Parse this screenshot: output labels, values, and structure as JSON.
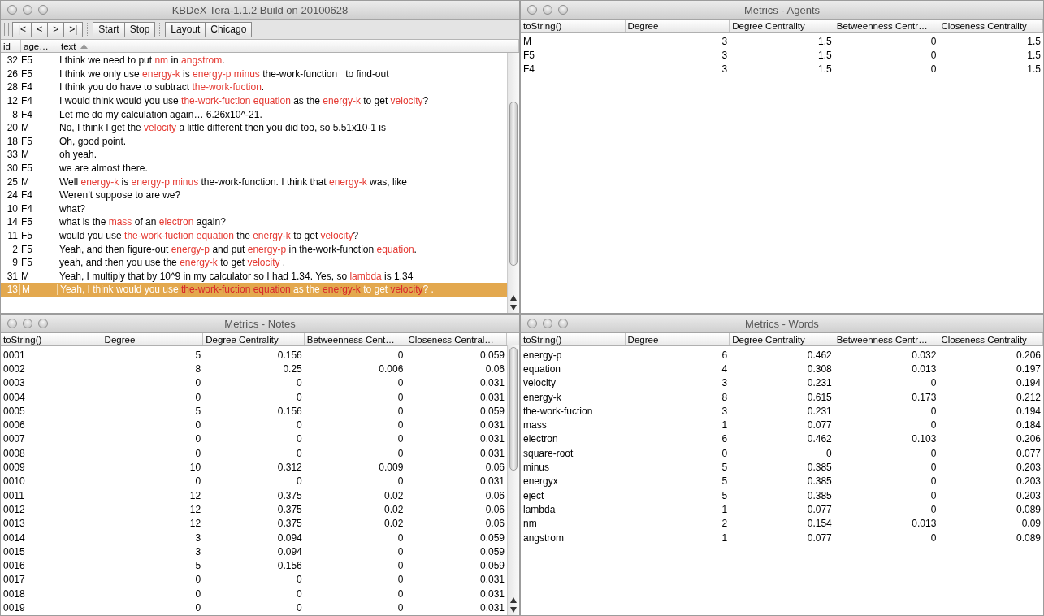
{
  "main_window": {
    "title": "KBDeX Tera-1.1.2 Build on 20100628",
    "toolbar_groups": [
      [
        "|<",
        "<",
        ">",
        ">|"
      ],
      [
        "Start",
        "Stop"
      ],
      [
        "Layout",
        "Chicago"
      ]
    ],
    "table": {
      "columns": [
        {
          "label": "id",
          "sorted": false
        },
        {
          "label": "age…",
          "sorted": false
        },
        {
          "label": "text",
          "sorted": true
        }
      ],
      "rows": [
        {
          "id": "32",
          "agent": "F5",
          "selected": false,
          "text": [
            {
              "t": "I think we need to put ",
              "keyword": false
            },
            {
              "t": "nm",
              "keyword": true
            },
            {
              "t": " in ",
              "keyword": false
            },
            {
              "t": "angstrom",
              "keyword": true
            },
            {
              "t": ".",
              "keyword": false
            }
          ]
        },
        {
          "id": "26",
          "agent": "F5",
          "selected": false,
          "text": [
            {
              "t": "I think we only use ",
              "keyword": false
            },
            {
              "t": "energy-k",
              "keyword": true
            },
            {
              "t": " is ",
              "keyword": false
            },
            {
              "t": "energy-p minus",
              "keyword": true
            },
            {
              "t": " the-work-function   to find-out",
              "keyword": false
            }
          ]
        },
        {
          "id": "28",
          "agent": "F4",
          "selected": false,
          "text": [
            {
              "t": "I think you do have to subtract ",
              "keyword": false
            },
            {
              "t": "the-work-fuction",
              "keyword": true
            },
            {
              "t": ".",
              "keyword": false
            }
          ]
        },
        {
          "id": "12",
          "agent": "F4",
          "selected": false,
          "text": [
            {
              "t": "I would think would you use ",
              "keyword": false
            },
            {
              "t": "the-work-fuction equation",
              "keyword": true
            },
            {
              "t": " as the ",
              "keyword": false
            },
            {
              "t": "energy-k",
              "keyword": true
            },
            {
              "t": " to get ",
              "keyword": false
            },
            {
              "t": "velocity",
              "keyword": true
            },
            {
              "t": "?",
              "keyword": false
            }
          ]
        },
        {
          "id": "8",
          "agent": "F4",
          "selected": false,
          "text": [
            {
              "t": "Let me do my calculation again… 6.26x10^-21.",
              "keyword": false
            }
          ]
        },
        {
          "id": "20",
          "agent": "M",
          "selected": false,
          "text": [
            {
              "t": "No, I think I get the ",
              "keyword": false
            },
            {
              "t": "velocity",
              "keyword": true
            },
            {
              "t": " a little different then you did too, so 5.51x10-1 is",
              "keyword": false
            }
          ]
        },
        {
          "id": "18",
          "agent": "F5",
          "selected": false,
          "text": [
            {
              "t": "Oh, good point.",
              "keyword": false
            }
          ]
        },
        {
          "id": "33",
          "agent": "M",
          "selected": false,
          "text": [
            {
              "t": "oh yeah.",
              "keyword": false
            }
          ]
        },
        {
          "id": "30",
          "agent": "F5",
          "selected": false,
          "text": [
            {
              "t": "we are almost there.",
              "keyword": false
            }
          ]
        },
        {
          "id": "25",
          "agent": "M",
          "selected": false,
          "text": [
            {
              "t": "Well ",
              "keyword": false
            },
            {
              "t": "energy-k",
              "keyword": true
            },
            {
              "t": " is ",
              "keyword": false
            },
            {
              "t": "energy-p minus",
              "keyword": true
            },
            {
              "t": " the-work-function. I think that ",
              "keyword": false
            },
            {
              "t": "energy-k",
              "keyword": true
            },
            {
              "t": " was, like",
              "keyword": false
            }
          ]
        },
        {
          "id": "24",
          "agent": "F4",
          "selected": false,
          "text": [
            {
              "t": "Weren’t suppose to are we?",
              "keyword": false
            }
          ]
        },
        {
          "id": "10",
          "agent": "F4",
          "selected": false,
          "text": [
            {
              "t": "what?",
              "keyword": false
            }
          ]
        },
        {
          "id": "14",
          "agent": "F5",
          "selected": false,
          "text": [
            {
              "t": "what is the ",
              "keyword": false
            },
            {
              "t": "mass",
              "keyword": true
            },
            {
              "t": " of an ",
              "keyword": false
            },
            {
              "t": "electron",
              "keyword": true
            },
            {
              "t": " again?",
              "keyword": false
            }
          ]
        },
        {
          "id": "11",
          "agent": "F5",
          "selected": false,
          "text": [
            {
              "t": "would you use ",
              "keyword": false
            },
            {
              "t": "the-work-fuction equation",
              "keyword": true
            },
            {
              "t": " the ",
              "keyword": false
            },
            {
              "t": "energy-k",
              "keyword": true
            },
            {
              "t": " to get ",
              "keyword": false
            },
            {
              "t": "velocity",
              "keyword": true
            },
            {
              "t": "?",
              "keyword": false
            }
          ]
        },
        {
          "id": "2",
          "agent": "F5",
          "selected": false,
          "text": [
            {
              "t": "Yeah, and then figure-out ",
              "keyword": false
            },
            {
              "t": "energy-p",
              "keyword": true
            },
            {
              "t": " and put ",
              "keyword": false
            },
            {
              "t": "energy-p",
              "keyword": true
            },
            {
              "t": " in the-work-function ",
              "keyword": false
            },
            {
              "t": "equation",
              "keyword": true
            },
            {
              "t": ".",
              "keyword": false
            }
          ]
        },
        {
          "id": "9",
          "agent": "F5",
          "selected": false,
          "text": [
            {
              "t": "yeah, and then you use the ",
              "keyword": false
            },
            {
              "t": "energy-k",
              "keyword": true
            },
            {
              "t": " to get ",
              "keyword": false
            },
            {
              "t": "velocity",
              "keyword": true
            },
            {
              "t": " .",
              "keyword": false
            }
          ]
        },
        {
          "id": "31",
          "agent": "M",
          "selected": false,
          "text": [
            {
              "t": "Yeah, I multiply that by 10^9 in my calculator so I had 1.34. Yes, so ",
              "keyword": false
            },
            {
              "t": "lambda",
              "keyword": true
            },
            {
              "t": " is 1.34",
              "keyword": false
            }
          ]
        },
        {
          "id": "13",
          "agent": "M",
          "selected": true,
          "text": [
            {
              "t": "Yeah, I think would you use ",
              "keyword": false
            },
            {
              "t": "the-work-fuction equation",
              "keyword": true
            },
            {
              "t": " as the ",
              "keyword": false
            },
            {
              "t": "energy-k",
              "keyword": true
            },
            {
              "t": " to get ",
              "keyword": false
            },
            {
              "t": "velocity",
              "keyword": true
            },
            {
              "t": "? .",
              "keyword": false
            }
          ]
        }
      ]
    }
  },
  "agents_window": {
    "title": "Metrics - Agents",
    "table": {
      "columns": [
        "toString()",
        "Degree",
        "Degree Centrality",
        "Betweenness Centr…",
        "Closeness Centrality"
      ],
      "rows": [
        [
          "M",
          "3",
          "1.5",
          "0",
          "1.5"
        ],
        [
          "F5",
          "3",
          "1.5",
          "0",
          "1.5"
        ],
        [
          "F4",
          "3",
          "1.5",
          "0",
          "1.5"
        ]
      ]
    }
  },
  "notes_window": {
    "title": "Metrics - Notes",
    "table": {
      "columns": [
        "toString()",
        "Degree",
        "Degree Centrality",
        "Betweenness Cent…",
        "Closeness Central…"
      ],
      "rows": [
        [
          "0001",
          "5",
          "0.156",
          "0",
          "0.059"
        ],
        [
          "0002",
          "8",
          "0.25",
          "0.006",
          "0.06"
        ],
        [
          "0003",
          "0",
          "0",
          "0",
          "0.031"
        ],
        [
          "0004",
          "0",
          "0",
          "0",
          "0.031"
        ],
        [
          "0005",
          "5",
          "0.156",
          "0",
          "0.059"
        ],
        [
          "0006",
          "0",
          "0",
          "0",
          "0.031"
        ],
        [
          "0007",
          "0",
          "0",
          "0",
          "0.031"
        ],
        [
          "0008",
          "0",
          "0",
          "0",
          "0.031"
        ],
        [
          "0009",
          "10",
          "0.312",
          "0.009",
          "0.06"
        ],
        [
          "0010",
          "0",
          "0",
          "0",
          "0.031"
        ],
        [
          "0011",
          "12",
          "0.375",
          "0.02",
          "0.06"
        ],
        [
          "0012",
          "12",
          "0.375",
          "0.02",
          "0.06"
        ],
        [
          "0013",
          "12",
          "0.375",
          "0.02",
          "0.06"
        ],
        [
          "0014",
          "3",
          "0.094",
          "0",
          "0.059"
        ],
        [
          "0015",
          "3",
          "0.094",
          "0",
          "0.059"
        ],
        [
          "0016",
          "5",
          "0.156",
          "0",
          "0.059"
        ],
        [
          "0017",
          "0",
          "0",
          "0",
          "0.031"
        ],
        [
          "0018",
          "0",
          "0",
          "0",
          "0.031"
        ],
        [
          "0019",
          "0",
          "0",
          "0",
          "0.031"
        ]
      ]
    }
  },
  "words_window": {
    "title": "Metrics - Words",
    "table": {
      "columns": [
        "toString()",
        "Degree",
        "Degree Centrality",
        "Betweenness Centr…",
        "Closeness Centrality"
      ],
      "rows": [
        [
          "energy-p",
          "6",
          "0.462",
          "0.032",
          "0.206"
        ],
        [
          "equation",
          "4",
          "0.308",
          "0.013",
          "0.197"
        ],
        [
          "velocity",
          "3",
          "0.231",
          "0",
          "0.194"
        ],
        [
          "energy-k",
          "8",
          "0.615",
          "0.173",
          "0.212"
        ],
        [
          "the-work-fuction",
          "3",
          "0.231",
          "0",
          "0.194"
        ],
        [
          "mass",
          "1",
          "0.077",
          "0",
          "0.184"
        ],
        [
          "electron",
          "6",
          "0.462",
          "0.103",
          "0.206"
        ],
        [
          "square-root",
          "0",
          "0",
          "0",
          "0.077"
        ],
        [
          "minus",
          "5",
          "0.385",
          "0",
          "0.203"
        ],
        [
          "energyx",
          "5",
          "0.385",
          "0",
          "0.203"
        ],
        [
          "eject",
          "5",
          "0.385",
          "0",
          "0.203"
        ],
        [
          "lambda",
          "1",
          "0.077",
          "0",
          "0.089"
        ],
        [
          "nm",
          "2",
          "0.154",
          "0.013",
          "0.09"
        ],
        [
          "angstrom",
          "1",
          "0.077",
          "0",
          "0.089"
        ]
      ]
    }
  }
}
